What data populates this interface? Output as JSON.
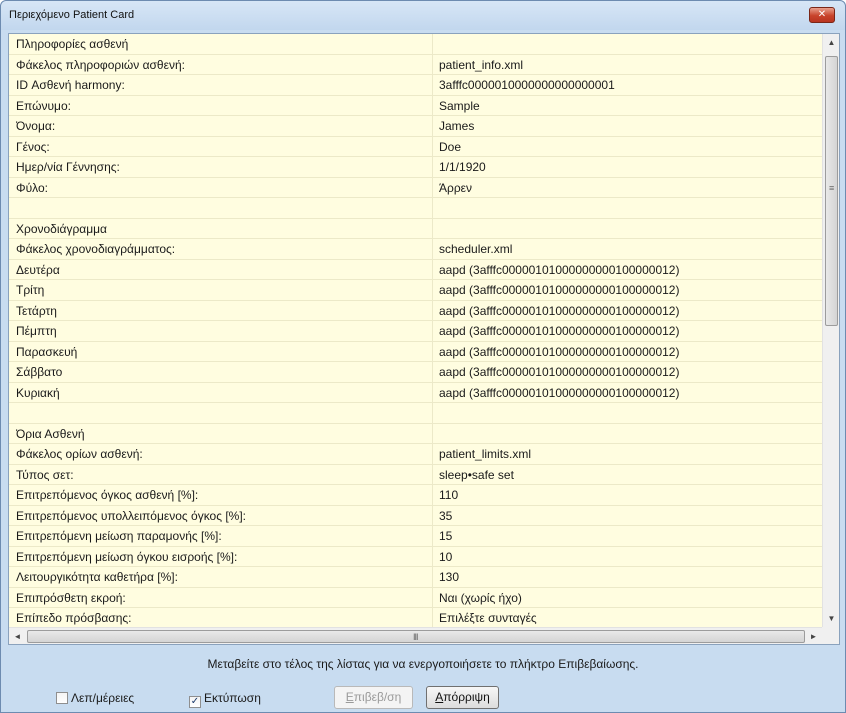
{
  "window": {
    "title": "Περιεχόμενο Patient Card",
    "close_glyph": "✕"
  },
  "rows": [
    {
      "key": "Πληροφορίες ασθενή",
      "value": ""
    },
    {
      "key": "Φάκελος πληροφοριών ασθενή:",
      "value": "patient_info.xml"
    },
    {
      "key": "ID Ασθενή harmony:",
      "value": "3afffc0000010000000000000001"
    },
    {
      "key": "Επώνυμο:",
      "value": "Sample"
    },
    {
      "key": "Όνομα:",
      "value": "James"
    },
    {
      "key": "Γένος:",
      "value": "Doe"
    },
    {
      "key": "Ημερ/νία Γέννησης:",
      "value": "1/1/1920"
    },
    {
      "key": "Φύλο:",
      "value": "Άρρεν"
    },
    {
      "key": "",
      "value": ""
    },
    {
      "key": "Χρονοδιάγραμμα",
      "value": ""
    },
    {
      "key": "Φάκελος χρονοδιαγράμματος:",
      "value": "scheduler.xml"
    },
    {
      "key": "Δευτέρα",
      "value": "aapd (3afffc00000101000000000100000012)"
    },
    {
      "key": "Τρίτη",
      "value": "aapd (3afffc00000101000000000100000012)"
    },
    {
      "key": "Τετάρτη",
      "value": "aapd (3afffc00000101000000000100000012)"
    },
    {
      "key": "Πέμπτη",
      "value": "aapd (3afffc00000101000000000100000012)"
    },
    {
      "key": "Παρασκευή",
      "value": "aapd (3afffc00000101000000000100000012)"
    },
    {
      "key": "Σάββατο",
      "value": "aapd (3afffc00000101000000000100000012)"
    },
    {
      "key": "Κυριακή",
      "value": "aapd (3afffc00000101000000000100000012)"
    },
    {
      "key": "",
      "value": ""
    },
    {
      "key": "Όρια Ασθενή",
      "value": ""
    },
    {
      "key": "Φάκελος ορίων ασθενή:",
      "value": "patient_limits.xml"
    },
    {
      "key": "Τύπος σετ:",
      "value": "sleep•safe set"
    },
    {
      "key": "Επιτρεπόμενος όγκος ασθενή [%]:",
      "value": "110"
    },
    {
      "key": "Επιτρεπόμενος υπολλειπόμενος όγκος [%]:",
      "value": "35"
    },
    {
      "key": "Επιτρεπόμενη μείωση παραμονής [%]:",
      "value": "15"
    },
    {
      "key": "Επιτρεπόμενη μείωση όγκου εισροής [%]:",
      "value": "10"
    },
    {
      "key": "Λειτουργικότητα καθετήρα [%]:",
      "value": "130"
    },
    {
      "key": "Επιπρόσθετη εκροή:",
      "value": "Ναι (χωρίς ήχο)"
    },
    {
      "key": "Επίπεδο πρόσβασης:",
      "value": "Επιλέξτε συνταγές"
    }
  ],
  "scrollbars": {
    "up": "▲",
    "down": "▼",
    "left": "◄",
    "right": "►",
    "vgrip": "≡",
    "hgrip": "III"
  },
  "footer": {
    "message": "Μεταβείτε στο τέλος της λίστας για να ενεργοποιήσετε το πλήκτρο Επιβεβαίωσης.",
    "details_label": "Λεπ/μέρειες",
    "details_checked": false,
    "print_label": "Εκτύπωση",
    "print_checked": true,
    "confirm_accel": "Ε",
    "confirm_rest": "πιβεβ/ση",
    "reject_accel": "Α",
    "reject_rest": "πόρριψη",
    "check_glyph": "✓"
  }
}
